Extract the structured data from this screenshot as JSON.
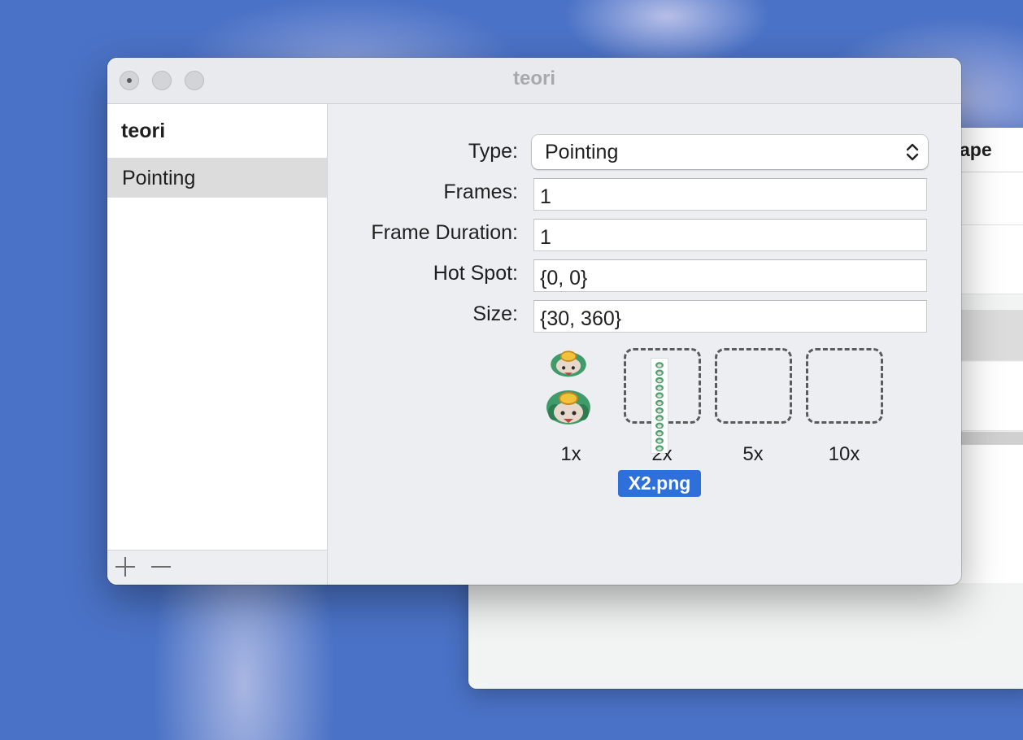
{
  "background_window": {
    "column_header": "ape"
  },
  "window": {
    "title": "teori"
  },
  "sidebar": {
    "header": "teori",
    "items": [
      {
        "label": "Pointing",
        "selected": true
      }
    ],
    "add_symbol": "+",
    "remove_symbol": "—"
  },
  "form": {
    "type": {
      "label": "Type:",
      "value": "Pointing"
    },
    "frames": {
      "label": "Frames:",
      "value": "1"
    },
    "frame_duration": {
      "label": "Frame Duration:",
      "value": "1"
    },
    "hot_spot": {
      "label": "Hot Spot:",
      "value": "{0, 0}"
    },
    "size": {
      "label": "Size:",
      "value": "{30, 360}"
    }
  },
  "image_wells": [
    {
      "scale": "1x",
      "has_image": true
    },
    {
      "scale": "2x",
      "has_image": false
    },
    {
      "scale": "5x",
      "has_image": false
    },
    {
      "scale": "10x",
      "has_image": false
    }
  ],
  "drag": {
    "filename": "X2.png"
  },
  "colors": {
    "desktop": "#4a72c6",
    "selection_badge": "#2f6fd9",
    "sidebar_selected": "#dcdcdd"
  }
}
